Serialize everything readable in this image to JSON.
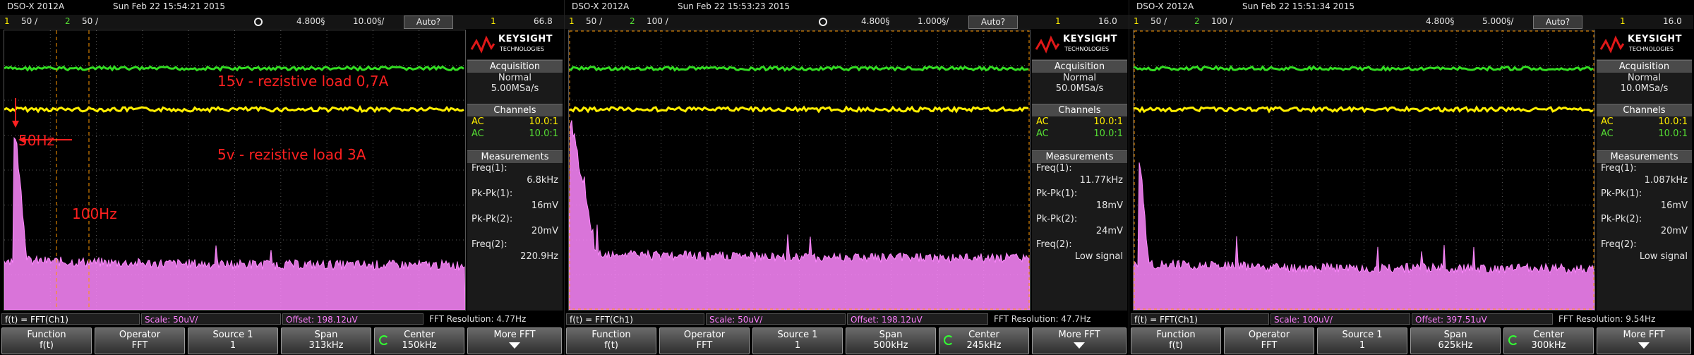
{
  "scopes": [
    {
      "model": "DSO-X 2012A",
      "date": "Sun Feb 22 15:54:21 2015",
      "ch1_num": "1",
      "ch1_scale": "50 ∕",
      "ch2_num": "2",
      "ch2_scale": "50 ∕",
      "timebase_delay": "4.800§",
      "timebase_scale": "10.00§/",
      "trigger_mode": "Auto?",
      "trigger_ch": "1",
      "trigger_level": "66.8",
      "brand": "KEYSIGHT",
      "brand_sub": "TECHNOLOGIES",
      "acq_header": "Acquisition",
      "acq_mode": "Normal",
      "acq_rate": "5.00MSa/s",
      "chan_header": "Channels",
      "chan1_coupling": "AC",
      "chan1_probe": "10.0:1",
      "chan2_coupling": "AC",
      "chan2_probe": "10.0:1",
      "meas_header": "Measurements",
      "m1_label": "Freq(1):",
      "m1_value": "6.8kHz",
      "m2_label": "Pk-Pk(1):",
      "m2_value": "16mV",
      "m3_label": "Pk-Pk(2):",
      "m3_value": "20mV",
      "m4_label": "Freq(2):",
      "m4_value": "220.9Hz",
      "fft_source": "f(t) = FFT(Ch1)",
      "fft_scale": "Scale: 50uV/",
      "fft_offset": "Offset: 198.12uV",
      "fft_resolution": "FFT Resolution: 4.77Hz",
      "keys": [
        {
          "title": "Function",
          "value": "f(t)"
        },
        {
          "title": "Operator",
          "value": "FFT"
        },
        {
          "title": "Source 1",
          "value": "1"
        },
        {
          "title": "Span",
          "value": "313kHz"
        },
        {
          "title": "Center",
          "value": "150kHz"
        },
        {
          "title": "More FFT",
          "value": ""
        }
      ],
      "annotations": {
        "a15v": "15v - rezistive load 0,7A",
        "a5v": "5v - rezistive load 3A",
        "a50": "50Hz",
        "a100": "100Hz"
      }
    },
    {
      "model": "DSO-X 2012A",
      "date": "Sun Feb 22 15:53:23 2015",
      "ch1_num": "1",
      "ch1_scale": "50 ∕",
      "ch2_num": "2",
      "ch2_scale": "100 ∕",
      "timebase_delay": "4.800§",
      "timebase_scale": "1.000§/",
      "trigger_mode": "Auto?",
      "trigger_ch": "1",
      "trigger_level": "16.0",
      "brand": "KEYSIGHT",
      "brand_sub": "TECHNOLOGIES",
      "acq_header": "Acquisition",
      "acq_mode": "Normal",
      "acq_rate": "50.0MSa/s",
      "chan_header": "Channels",
      "chan1_coupling": "AC",
      "chan1_probe": "10.0:1",
      "chan2_coupling": "AC",
      "chan2_probe": "10.0:1",
      "meas_header": "Measurements",
      "m1_label": "Freq(1):",
      "m1_value": "11.77kHz",
      "m2_label": "Pk-Pk(1):",
      "m2_value": "18mV",
      "m3_label": "Pk-Pk(2):",
      "m3_value": "24mV",
      "m4_label": "Freq(2):",
      "m4_value": "Low signal",
      "fft_source": "f(t) = FFT(Ch1)",
      "fft_scale": "Scale: 50uV/",
      "fft_offset": "Offset: 198.12uV",
      "fft_resolution": "FFT Resolution: 47.7Hz",
      "keys": [
        {
          "title": "Function",
          "value": "f(t)"
        },
        {
          "title": "Operator",
          "value": "FFT"
        },
        {
          "title": "Source 1",
          "value": "1"
        },
        {
          "title": "Span",
          "value": "500kHz"
        },
        {
          "title": "Center",
          "value": "245kHz"
        },
        {
          "title": "More FFT",
          "value": ""
        }
      ]
    },
    {
      "model": "DSO-X 2012A",
      "date": "Sun Feb 22 15:51:34 2015",
      "ch1_num": "1",
      "ch1_scale": "50 ∕",
      "ch2_num": "2",
      "ch2_scale": "100 ∕",
      "timebase_delay": "4.800§",
      "timebase_scale": "5.000§/",
      "trigger_mode": "Auto?",
      "trigger_ch": "1",
      "trigger_level": "16.0",
      "brand": "KEYSIGHT",
      "brand_sub": "TECHNOLOGIES",
      "acq_header": "Acquisition",
      "acq_mode": "Normal",
      "acq_rate": "10.0MSa/s",
      "chan_header": "Channels",
      "chan1_coupling": "AC",
      "chan1_probe": "10.0:1",
      "chan2_coupling": "AC",
      "chan2_probe": "10.0:1",
      "meas_header": "Measurements",
      "m1_label": "Freq(1):",
      "m1_value": "1.087kHz",
      "m2_label": "Pk-Pk(1):",
      "m2_value": "16mV",
      "m3_label": "Pk-Pk(2):",
      "m3_value": "20mV",
      "m4_label": "Freq(2):",
      "m4_value": "Low signal",
      "fft_source": "f(t) = FFT(Ch1)",
      "fft_scale": "Scale: 100uV/",
      "fft_offset": "Offset: 397.51uV",
      "fft_resolution": "FFT Resolution: 9.54Hz",
      "keys": [
        {
          "title": "Function",
          "value": "f(t)"
        },
        {
          "title": "Operator",
          "value": "FFT"
        },
        {
          "title": "Source 1",
          "value": "1"
        },
        {
          "title": "Span",
          "value": "625kHz"
        },
        {
          "title": "Center",
          "value": "300kHz"
        },
        {
          "title": "More FFT",
          "value": ""
        }
      ]
    }
  ],
  "colors": {
    "ch1": "#ffee00",
    "ch2": "#33dd22",
    "fft": "#ff88ff",
    "grid": "#5a5a5a",
    "annotation": "#ff2020"
  }
}
